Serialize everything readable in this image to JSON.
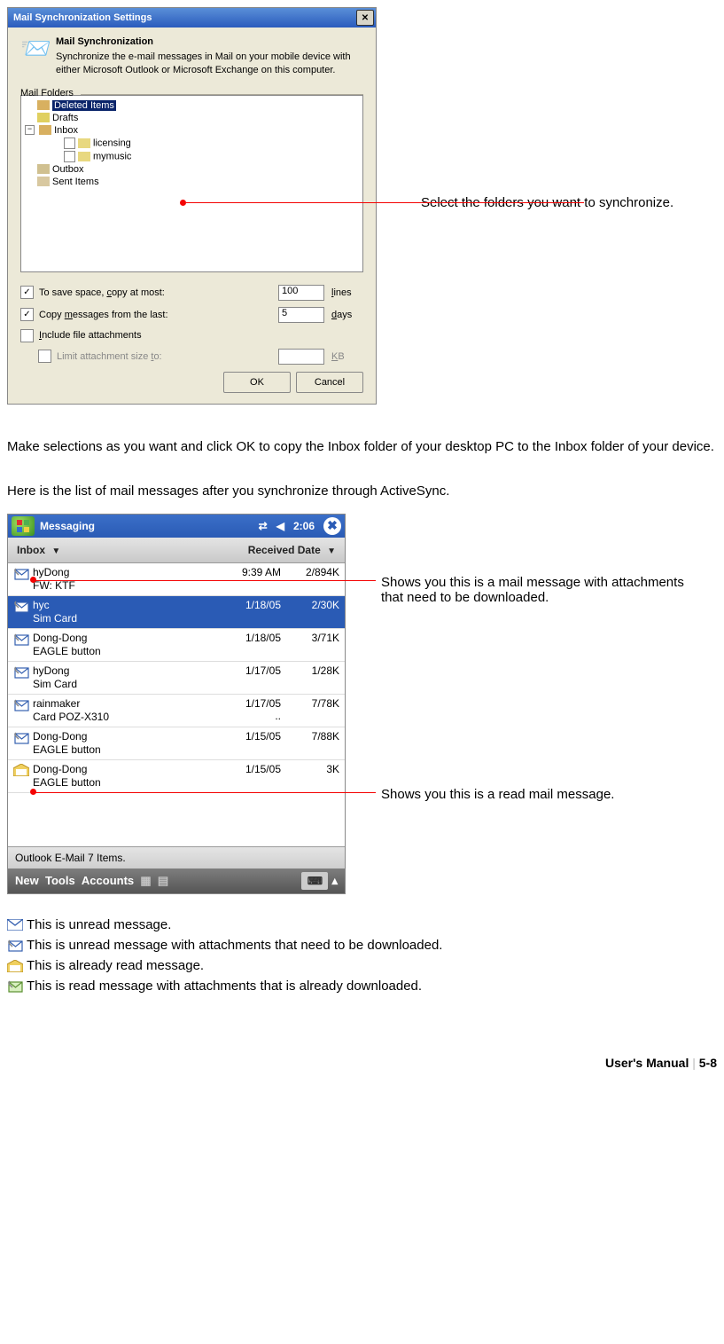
{
  "dialog": {
    "title": "Mail Synchronization Settings",
    "heading": "Mail Synchronization",
    "desc": "Synchronize the e-mail messages in Mail on your mobile device with either Microsoft Outlook or Microsoft Exchange on this computer.",
    "group_label": "Mail Folders",
    "tree": {
      "deleted": "Deleted Items",
      "drafts": "Drafts",
      "inbox": "Inbox",
      "licensing": "licensing",
      "mymusic": "mymusic",
      "outbox": "Outbox",
      "sent": "Sent Items"
    },
    "opt_copy_lines_label": "To save space, copy at most:",
    "opt_copy_lines_value": "100",
    "opt_copy_lines_unit": "lines",
    "opt_days_label": "Copy messages from the last:",
    "opt_days_value": "5",
    "opt_days_unit": "days",
    "opt_include_label": "Include file attachments",
    "opt_limit_label": "Limit attachment size to:",
    "opt_limit_unit": "KB",
    "ok": "OK",
    "cancel": "Cancel"
  },
  "callouts": {
    "select_folders": "Select the folders you want to synchronize.",
    "attachment_msg": "Shows you this is a mail message with attachments that need to be downloaded.",
    "read_msg": "Shows you this is a read mail message."
  },
  "para1": "Make selections as you want and click OK to copy the Inbox folder of your desktop PC to the Inbox folder of your device.",
  "para2": "Here is the list of mail messages after you synchronize through ActiveSync.",
  "device": {
    "app": "Messaging",
    "time": "2:06",
    "inbox_header": "Inbox",
    "received_header": "Received Date",
    "messages": [
      {
        "sender": "hyDong",
        "subject": "FW: KTF",
        "date": "9:39 AM",
        "size": "2/894K",
        "selected": false,
        "icon": "unread-attach"
      },
      {
        "sender": "hyc",
        "subject": "Sim Card",
        "date": "1/18/05",
        "size": "2/30K",
        "selected": true,
        "icon": "unread-attach"
      },
      {
        "sender": "Dong-Dong",
        "subject": "EAGLE button",
        "date": "1/18/05",
        "size": "3/71K",
        "selected": false,
        "icon": "unread-attach"
      },
      {
        "sender": "hyDong",
        "subject": "Sim Card",
        "date": "1/17/05",
        "size": "1/28K",
        "selected": false,
        "icon": "unread-attach"
      },
      {
        "sender": "rainmaker",
        "subject": "Card POZ-X310",
        "date": "1/17/05",
        "size": "7/78K",
        "size_extra": "..",
        "selected": false,
        "icon": "unread-attach"
      },
      {
        "sender": "Dong-Dong",
        "subject": "EAGLE button",
        "date": "1/15/05",
        "size": "7/88K",
        "selected": false,
        "icon": "unread-attach"
      },
      {
        "sender": "Dong-Dong",
        "subject": "EAGLE button",
        "date": "1/15/05",
        "size": "3K",
        "selected": false,
        "icon": "read"
      }
    ],
    "footer_status": "Outlook E-Mail  7 Items.",
    "menu_new": "New",
    "menu_tools": "Tools",
    "menu_accounts": "Accounts"
  },
  "legend": {
    "unread": "This is unread message.",
    "unread_attach": "This is unread message with attachments that need to be downloaded.",
    "read": "This is already read message.",
    "read_attach": "This is read message with attachments that is already downloaded."
  },
  "footer": {
    "manual": "User's Manual",
    "page": "5-8"
  }
}
